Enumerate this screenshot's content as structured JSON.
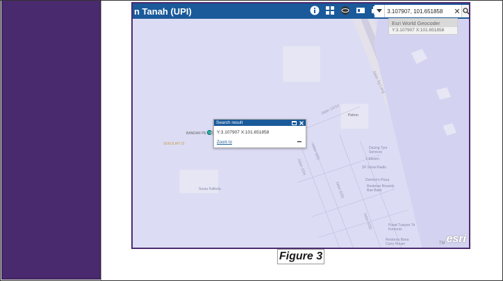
{
  "app": {
    "title": "n Tanah (UPI)"
  },
  "toolbar": {
    "icons": [
      "info-icon",
      "grid-icon",
      "layers-icon",
      "basemap-icon",
      "print-icon"
    ]
  },
  "search": {
    "value": "3.107907, 101.651858",
    "clear_label": "✕",
    "suggestions": {
      "source": "Esri World Geocoder",
      "item": "Y:3.107907 X:101.651858"
    }
  },
  "popup": {
    "title": "Search result",
    "content": "Y:3.107907 X:101.651858",
    "zoom_label": "Zoom to",
    "more_label": "•••"
  },
  "map_labels": {
    "bandar": "BANDAR PE",
    "road1": "Jalan 10/4",
    "road2": "Jalan 10/14",
    "road3": "Jalan 6/33",
    "road4": "Jalan 6/31",
    "road5": "Jalan 6/30",
    "petrol": "Petron",
    "dazing": "Dazing Tyre Services",
    "eleven": "7-Eleven",
    "sf": "SF Seoul Radio",
    "dominos": "Domino's Pizza",
    "bakery": "Restoran Rossely Bae Bank",
    "pusat": "Pusat Tuisyen Tri Komunis",
    "restoran": "Restoran Bana Curry House",
    "katholik": "Surau Kathola",
    "sekolah": "SEKOLAH 15",
    "jalan_sg": "Jalan Sg Lang"
  },
  "attribution": {
    "tm": "TM",
    "logo": "esri"
  },
  "caption": "Figure 3",
  "colors": {
    "sidebar": "#4a2a6e",
    "header": "#1a5a9a",
    "map_bg": "#dcdcf4"
  }
}
